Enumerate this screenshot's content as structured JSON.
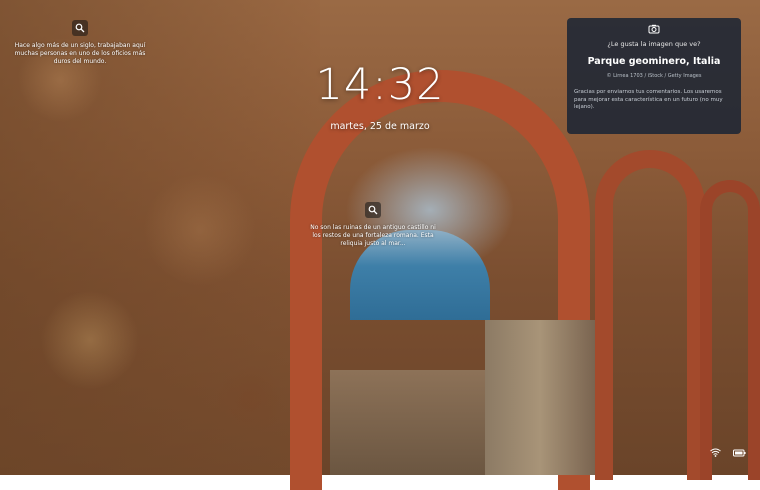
{
  "lockscreen": {
    "time": "14:32",
    "date": "martes, 25 de marzo"
  },
  "hotspot_left": {
    "text": "Hace algo más de un siglo, trabajaban aquí muchas personas en uno de los oficios más duros del mundo."
  },
  "hotspot_center": {
    "text": "No son las ruinas de un antiguo castillo ni los restos de una fortaleza romana. Esta reliquia justo al mar..."
  },
  "spotlight_card": {
    "question": "¿Le gusta la imagen que ve?",
    "title": "Parque geominero, Italia",
    "credit": "© Lirnea 1703 / iStock / Getty Images",
    "message": "Gracias por enviarnos tus comentarios. Los usaremos para mejorar esta característica en un futuro (no muy lejano)."
  },
  "icons": {
    "hotspot": "magnifier-icon",
    "camera": "camera-icon",
    "wifi": "wifi-icon",
    "battery": "battery-icon"
  }
}
